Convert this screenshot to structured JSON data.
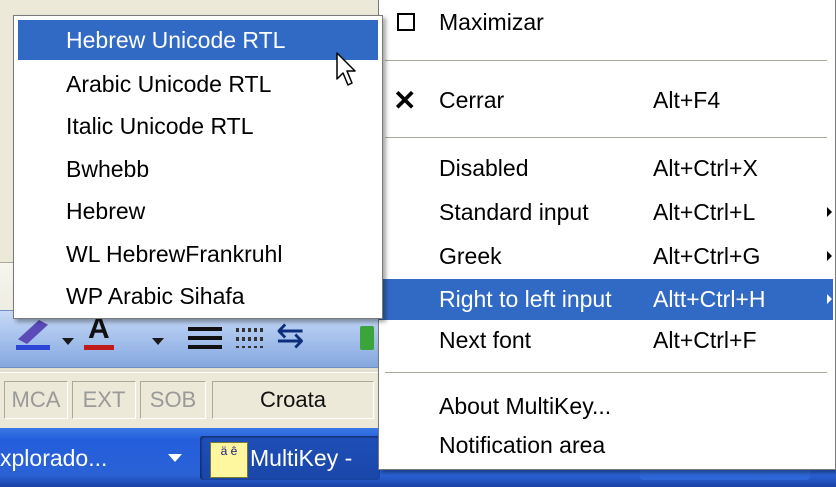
{
  "status_bar": {
    "cells": [
      "MCA",
      "EXT",
      "SOB"
    ],
    "language": "Croata"
  },
  "taskbar": {
    "explorer_label": "xplorado...",
    "multikey_label": "MultiKey -",
    "multikey_icon_text": "ä ê"
  },
  "menu": {
    "items": [
      {
        "label": "Maximizar",
        "accel": "",
        "icon": "maximize-icon"
      },
      {
        "label": "Cerrar",
        "accel": "Alt+F4",
        "icon": "close-icon"
      },
      {
        "label": "Disabled",
        "accel": "Alt+Ctrl+X"
      },
      {
        "label": "Standard input",
        "accel": "Alt+Ctrl+L",
        "submenu": true
      },
      {
        "label": "Greek",
        "accel": "Alt+Ctrl+G",
        "submenu": true
      },
      {
        "label": "Right to left input",
        "accel": "Altt+Ctrl+H",
        "submenu": true,
        "highlighted": true
      },
      {
        "label": "Next font",
        "accel": "Alt+Ctrl+F"
      },
      {
        "label": "About MultiKey...",
        "accel": ""
      },
      {
        "label": "Notification area",
        "accel": ""
      }
    ]
  },
  "submenu": {
    "items": [
      {
        "label": "Hebrew Unicode RTL",
        "highlighted": true
      },
      {
        "label": "Arabic Unicode RTL"
      },
      {
        "label": "Italic Unicode RTL"
      },
      {
        "label": "Bwhebb"
      },
      {
        "label": "Hebrew"
      },
      {
        "label": "WL HebrewFrankruhl"
      },
      {
        "label": "WP Arabic Sihafa"
      }
    ]
  },
  "colors": {
    "highlight": "#316ac5",
    "taskbar": "#245edb",
    "face": "#ece9d8"
  }
}
